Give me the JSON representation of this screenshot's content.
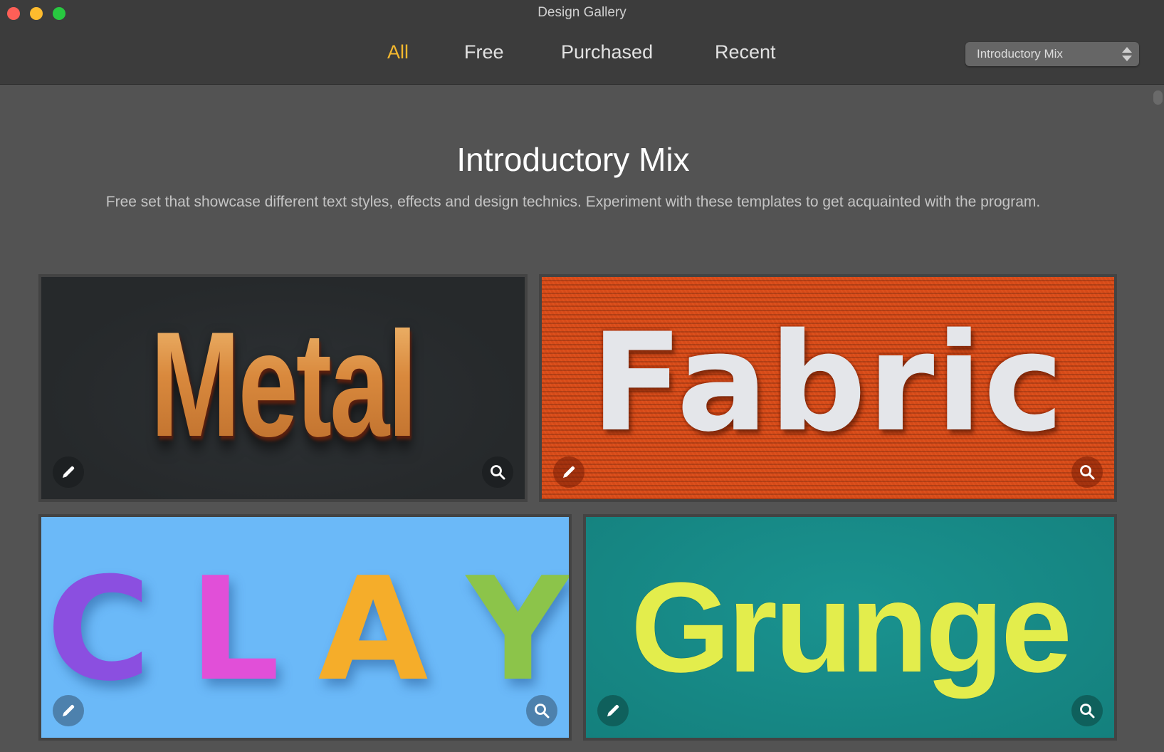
{
  "window": {
    "title": "Design Gallery"
  },
  "tabs": [
    {
      "label": "All",
      "active": true
    },
    {
      "label": "Free",
      "active": false
    },
    {
      "label": "Purchased",
      "active": false
    },
    {
      "label": "Recent",
      "active": false
    }
  ],
  "collection_select": {
    "value": "Introductory Mix"
  },
  "collection": {
    "title": "Introductory Mix",
    "description": "Free set that showcase different text styles, effects and design technics. Experiment with these templates to get acquainted with the program."
  },
  "colors": {
    "accent": "#f5b82e",
    "toolbar_bg": "#3c3c3c",
    "content_bg": "#535353"
  },
  "templates": [
    {
      "name": "Metal",
      "art_text": "Metal",
      "background": "#26292b",
      "edit_icon": "pencil-icon",
      "preview_icon": "magnifier-icon"
    },
    {
      "name": "Fabric",
      "art_text": "Fabric",
      "background": "#d64a18",
      "edit_icon": "pencil-icon",
      "preview_icon": "magnifier-icon"
    },
    {
      "name": "Clay",
      "art_text": [
        "C",
        "L",
        "A",
        "Y"
      ],
      "letter_colors": [
        "#8b4fe0",
        "#e14fd8",
        "#f5ad2a",
        "#8cc44a"
      ],
      "background": "#6bb9f8",
      "edit_icon": "pencil-icon",
      "preview_icon": "magnifier-icon"
    },
    {
      "name": "Grunge",
      "art_text": "Grunge",
      "background": "#16897f",
      "edit_icon": "pencil-icon",
      "preview_icon": "magnifier-icon"
    }
  ]
}
